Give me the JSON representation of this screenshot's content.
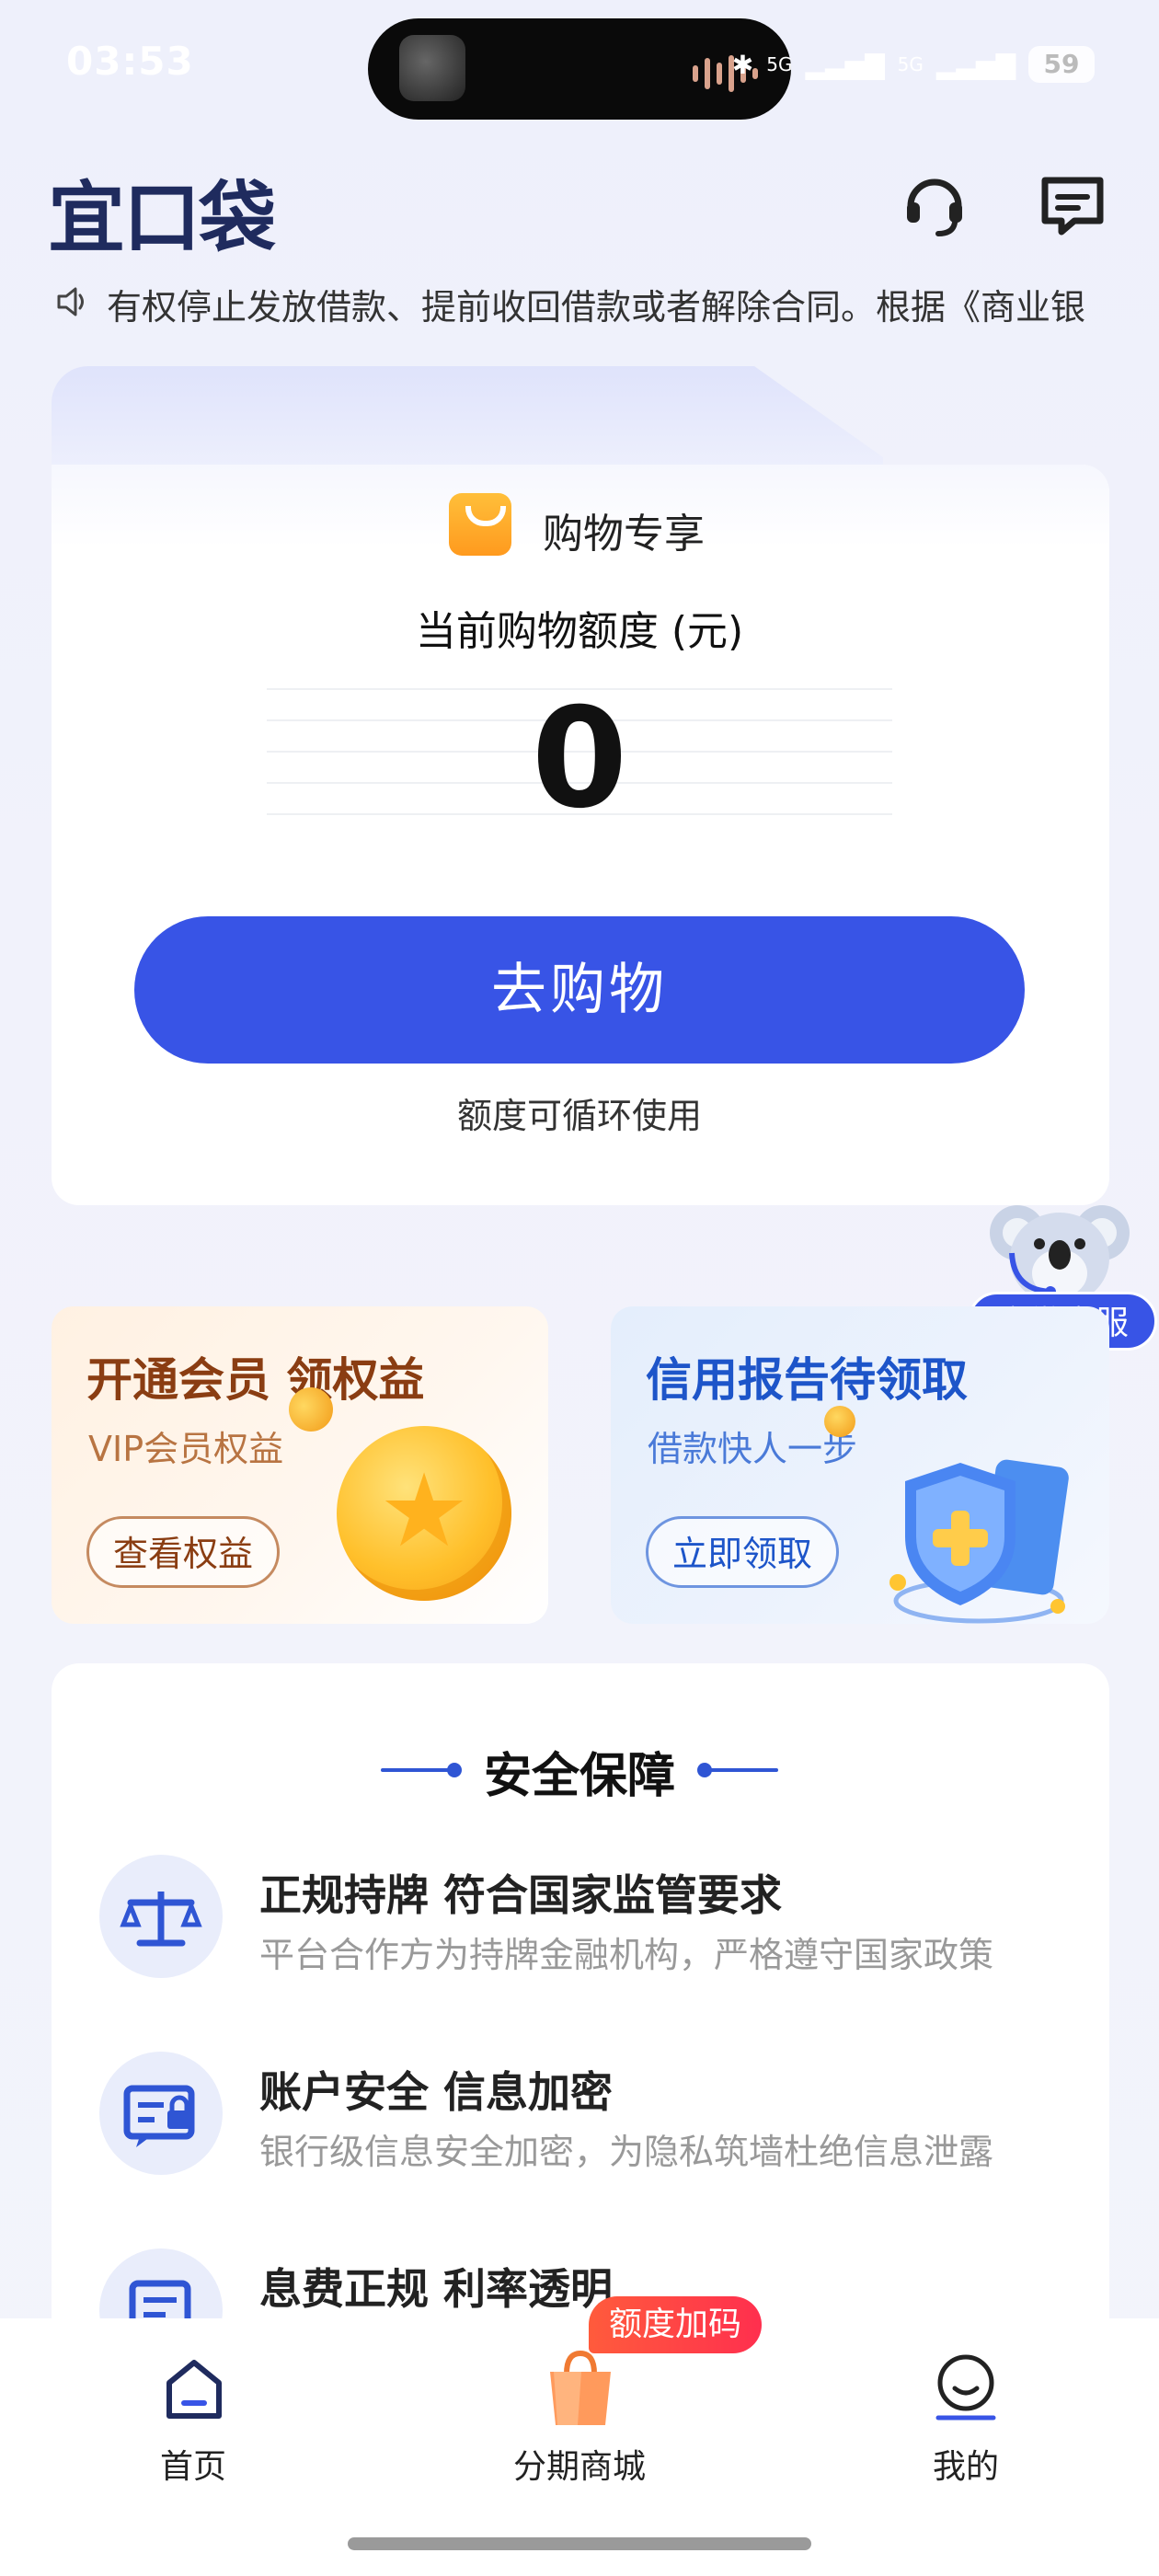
{
  "status_bar": {
    "time": "03:53",
    "signal_1": "5G",
    "signal_2": "5G",
    "battery": "59"
  },
  "header": {
    "logo": "宜口袋"
  },
  "notice": {
    "text": "有权停止发放借款、提前收回借款或者解除合同。根据《商业银"
  },
  "quota_card": {
    "section_label": "购物专享",
    "quota_label": "当前购物额度 (元)",
    "quota_value": "0",
    "cta_label": "去购物",
    "footnote": "额度可循环使用"
  },
  "floating_service": {
    "label": "企微客服"
  },
  "promos": [
    {
      "title": "开通会员 领权益",
      "subtitle": "VIP会员权益",
      "button": "查看权益"
    },
    {
      "title": "信用报告待领取",
      "subtitle": "借款快人一步",
      "button": "立即领取"
    }
  ],
  "security": {
    "title": "安全保障",
    "items": [
      {
        "title": "正规持牌 符合国家监管要求",
        "desc": "平台合作方为持牌金融机构，严格遵守国家政策"
      },
      {
        "title": "账户安全 信息加密",
        "desc": "银行级信息安全加密，为隐私筑墙杜绝信息泄露"
      },
      {
        "title": "息费正规  利率透明",
        "desc": ""
      }
    ]
  },
  "tabbar": {
    "items": [
      {
        "label": "首页"
      },
      {
        "label": "分期商城"
      },
      {
        "label": "我的"
      }
    ],
    "badge": "额度加码"
  },
  "colors": {
    "primary": "#3854e6",
    "title_dark": "#1f2b5e",
    "promo_left_accent": "#8a3d12",
    "promo_right_accent": "#1d55c9"
  }
}
